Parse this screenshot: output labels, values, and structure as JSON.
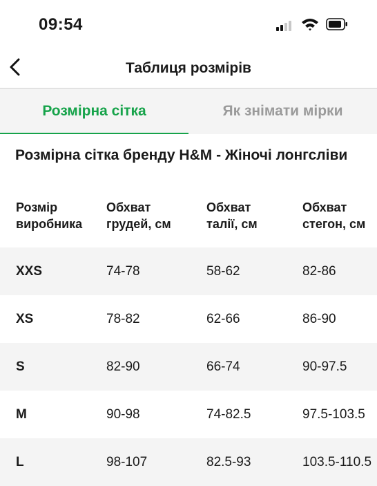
{
  "status_bar": {
    "time": "09:54"
  },
  "nav": {
    "title": "Таблиця розмірів"
  },
  "tabs": [
    {
      "label": "Розмірна сітка",
      "active": true
    },
    {
      "label": "Як знімати мірки",
      "active": false
    }
  ],
  "section_title": "Розмірна сітка бренду H&M - Жіночі лонгсліви",
  "table": {
    "headers": [
      "Розмір виробника",
      "Обхват грудей, см",
      "Обхват талії, см",
      "Обхват стегон, см"
    ],
    "rows": [
      [
        "XXS",
        "74-78",
        "58-62",
        "82-86"
      ],
      [
        "XS",
        "78-82",
        "62-66",
        "86-90"
      ],
      [
        "S",
        "82-90",
        "66-74",
        "90-97.5"
      ],
      [
        "M",
        "90-98",
        "74-82.5",
        "97.5-103.5"
      ],
      [
        "L",
        "98-107",
        "82.5-93",
        "103.5-110.5"
      ]
    ]
  },
  "colors": {
    "accent": "#16a34a",
    "inactive_tab": "#9a9a9a",
    "shaded_row": "#f4f4f4"
  }
}
